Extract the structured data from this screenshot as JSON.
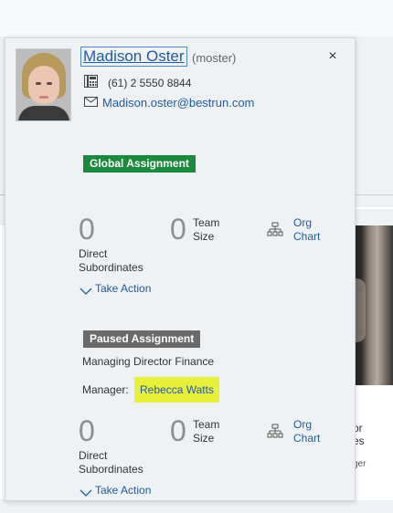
{
  "popover": {
    "name": "Madison Oster",
    "username": "(moster)",
    "phone": "(61) 2 5550 8844",
    "email": "Madison.oster@bestrun.com",
    "close_glyph": "×",
    "icons": {
      "avatar": "person-photo",
      "phone": "phone-icon",
      "mail": "mail-icon",
      "close": "close-icon",
      "org_chart": "org-chart-icon",
      "expand": "chevron-down-icon"
    }
  },
  "assignments": [
    {
      "badge": "Global Assignment",
      "badge_color": "#1b8a3d",
      "direct_subordinates_count": "0",
      "direct_subordinates_label_1": "Direct",
      "direct_subordinates_label_2": "Subordinates",
      "team_size_count": "0",
      "team_size_label_1": "Team",
      "team_size_label_2": "Size",
      "org_chart_label_1": "Org",
      "org_chart_label_2": "Chart",
      "take_action": "Take Action"
    },
    {
      "badge": "Paused Assignment",
      "badge_color": "#6a6a6a",
      "job_title": "Managing Director Finance",
      "manager_label": "Manager:",
      "manager_name": "Rebecca Watts",
      "manager_highlight": "#e8f03a",
      "direct_subordinates_count": "0",
      "direct_subordinates_label_1": "Direct",
      "direct_subordinates_label_2": "Subordinates",
      "team_size_count": "0",
      "team_size_label_1": "Team",
      "team_size_label_2": "Size",
      "org_chart_label_1": "Org",
      "org_chart_label_2": "Chart",
      "take_action": "Take Action"
    }
  ],
  "background_card": {
    "line_1": "or",
    "line_2": "es",
    "line_3": "ger"
  },
  "colors": {
    "link": "#1f5aa6",
    "popover_bg": "#eff2f4",
    "page_bg": "#eef2f5"
  }
}
